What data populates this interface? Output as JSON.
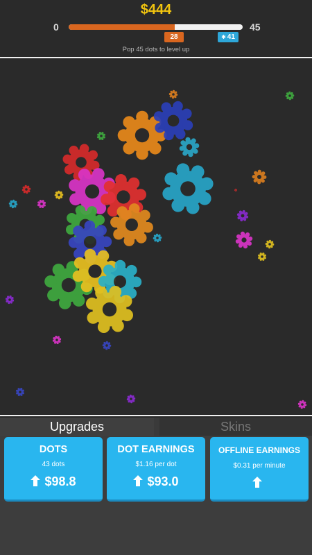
{
  "header": {
    "money": "$444",
    "level_min": "0",
    "level_max": "45",
    "progress_fraction": 0.61,
    "popped_count": "28",
    "target_count": "41",
    "hint": "Pop 45 dots to level up"
  },
  "tabs": {
    "upgrades": "Upgrades",
    "skins": "Skins"
  },
  "cards": [
    {
      "title": "DOTS",
      "subtitle": "43 dots",
      "price": "$98.8"
    },
    {
      "title": "DOT EARNINGS",
      "subtitle": "$1.16 per dot",
      "price": "$93.0"
    },
    {
      "title": "OFFLINE EARNINGS",
      "subtitle": "$0.31 per minute",
      "price": ""
    }
  ],
  "colors": {
    "money": "#f1c40f",
    "progress": "#d9661f",
    "badge": "#2ea7d9",
    "card": "#29b6ef",
    "background": "#2a2a2a"
  }
}
